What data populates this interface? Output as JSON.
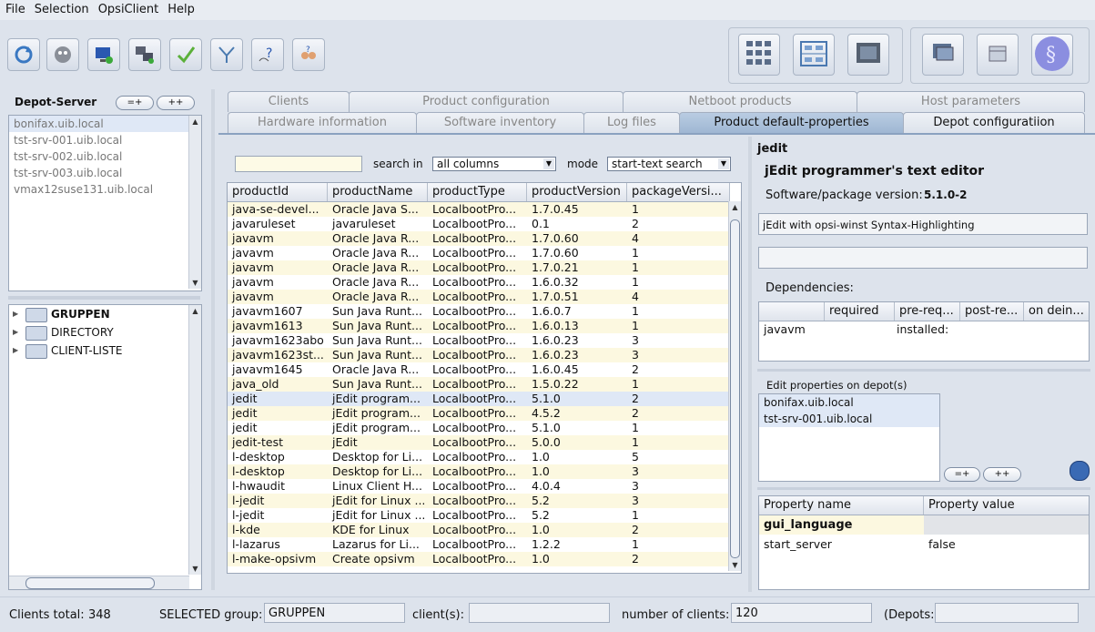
{
  "menu": [
    "File",
    "Selection",
    "OpsiClient",
    "Help"
  ],
  "toolbar": {
    "buttons": [
      "reload-icon",
      "ghost-icon",
      "monitor-add-icon",
      "computers-icon",
      "checkmark-icon",
      "filter-icon",
      "wifi-help-icon",
      "people-help-icon"
    ],
    "right_group1": [
      "grid-view-icon",
      "network-view-icon",
      "screen-icon"
    ],
    "right_group2": [
      "windows-icon",
      "package-icon",
      "opsi-logo-icon"
    ]
  },
  "depot": {
    "title": "Depot-Server",
    "btn_equal": "=+",
    "btn_plus": "++",
    "servers": [
      "bonifax.uib.local",
      "tst-srv-001.uib.local",
      "tst-srv-002.uib.local",
      "tst-srv-003.uib.local",
      "vmax12suse131.uib.local"
    ]
  },
  "tree": [
    "GRUPPEN",
    "DIRECTORY",
    "CLIENT-LISTE"
  ],
  "tabs_row1": [
    "Clients",
    "Product configuration",
    "Netboot products",
    "Host parameters"
  ],
  "tabs_row2": [
    "Hardware information",
    "Software inventory",
    "Log files",
    "Product default-properties",
    "Depot configuratiion"
  ],
  "search": {
    "value": "",
    "search_in_label": "search in",
    "search_in_value": "all columns",
    "mode_label": "mode",
    "mode_value": "start-text search"
  },
  "table": {
    "columns": [
      "productId",
      "productName",
      "productType",
      "productVersion",
      "packageVersi..."
    ],
    "rows": [
      [
        "java-se-devel...",
        "Oracle Java S...",
        "LocalbootPro...",
        "1.7.0.45",
        "1"
      ],
      [
        "javaruleset",
        "javaruleset",
        "LocalbootPro...",
        "0.1",
        "2"
      ],
      [
        "javavm",
        "Oracle Java R...",
        "LocalbootPro...",
        "1.7.0.60",
        "4"
      ],
      [
        "javavm",
        "Oracle Java R...",
        "LocalbootPro...",
        "1.7.0.60",
        "1"
      ],
      [
        "javavm",
        "Oracle Java R...",
        "LocalbootPro...",
        "1.7.0.21",
        "1"
      ],
      [
        "javavm",
        "Oracle Java R...",
        "LocalbootPro...",
        "1.6.0.32",
        "1"
      ],
      [
        "javavm",
        "Oracle Java R...",
        "LocalbootPro...",
        "1.7.0.51",
        "4"
      ],
      [
        "javavm1607",
        "Sun Java Runt...",
        "LocalbootPro...",
        "1.6.0.7",
        "1"
      ],
      [
        "javavm1613",
        "Sun Java Runt...",
        "LocalbootPro...",
        "1.6.0.13",
        "1"
      ],
      [
        "javavm1623abo",
        "Sun Java Runt...",
        "LocalbootPro...",
        "1.6.0.23",
        "3"
      ],
      [
        "javavm1623st...",
        "Sun Java Runt...",
        "LocalbootPro...",
        "1.6.0.23",
        "3"
      ],
      [
        "javavm1645",
        "Oracle Java R...",
        "LocalbootPro...",
        "1.6.0.45",
        "2"
      ],
      [
        "java_old",
        "Sun Java Runt...",
        "LocalbootPro...",
        "1.5.0.22",
        "1"
      ],
      [
        "jedit",
        "jEdit program...",
        "LocalbootPro...",
        "5.1.0",
        "2"
      ],
      [
        "jedit",
        "jEdit program...",
        "LocalbootPro...",
        "4.5.2",
        "2"
      ],
      [
        "jedit",
        "jEdit program...",
        "LocalbootPro...",
        "5.1.0",
        "1"
      ],
      [
        "jedit-test",
        "jEdit",
        "LocalbootPro...",
        "5.0.0",
        "1"
      ],
      [
        "l-desktop",
        "Desktop for Li...",
        "LocalbootPro...",
        "1.0",
        "5"
      ],
      [
        "l-desktop",
        "Desktop for Li...",
        "LocalbootPro...",
        "1.0",
        "3"
      ],
      [
        "l-hwaudit",
        "Linux Client H...",
        "LocalbootPro...",
        "4.0.4",
        "3"
      ],
      [
        "l-jedit",
        "jEdit for Linux ...",
        "LocalbootPro...",
        "5.2",
        "3"
      ],
      [
        "l-jedit",
        "jEdit for Linux ...",
        "LocalbootPro...",
        "5.2",
        "1"
      ],
      [
        "l-kde",
        "KDE for Linux",
        "LocalbootPro...",
        "1.0",
        "2"
      ],
      [
        "l-lazarus",
        "Lazarus for Li...",
        "LocalbootPro...",
        "1.2.2",
        "1"
      ],
      [
        "l-make-opsivm",
        "Create opsivm",
        "LocalbootPro...",
        "1.0",
        "2"
      ]
    ]
  },
  "detail": {
    "product_id": "jedit",
    "product_name": "jEdit programmer's text editor",
    "version_label": "Software/package version:",
    "version_value": "5.1.0-2",
    "description": "jEdit with opsi-winst Syntax-Highlighting",
    "advice": "",
    "dependencies_label": "Dependencies:",
    "dep_columns": [
      "",
      "required",
      "pre-req...",
      "post-re...",
      "on dein..."
    ],
    "dep_rows": [
      [
        "javavm",
        "",
        "installed:",
        "",
        ""
      ]
    ],
    "edit_props_label": "Edit properties on depot(s)",
    "depots": [
      "bonifax.uib.local",
      "tst-srv-001.uib.local"
    ],
    "btn_equal": "=+",
    "btn_plus": "++",
    "prop_columns": [
      "Property name",
      "Property value"
    ],
    "prop_rows": [
      [
        "gui_language",
        ""
      ],
      [
        "start_server",
        "false"
      ]
    ]
  },
  "status": {
    "clients_total_label": "Clients total:",
    "clients_total_value": "348",
    "selected_group_label": "SELECTED group:",
    "selected_group_value": "GRUPPEN",
    "clients_label": "client(s):",
    "clients_value": "",
    "number_label": "number of clients:",
    "number_value": "120",
    "depots_label": "(Depots:",
    "depots_value": ""
  }
}
